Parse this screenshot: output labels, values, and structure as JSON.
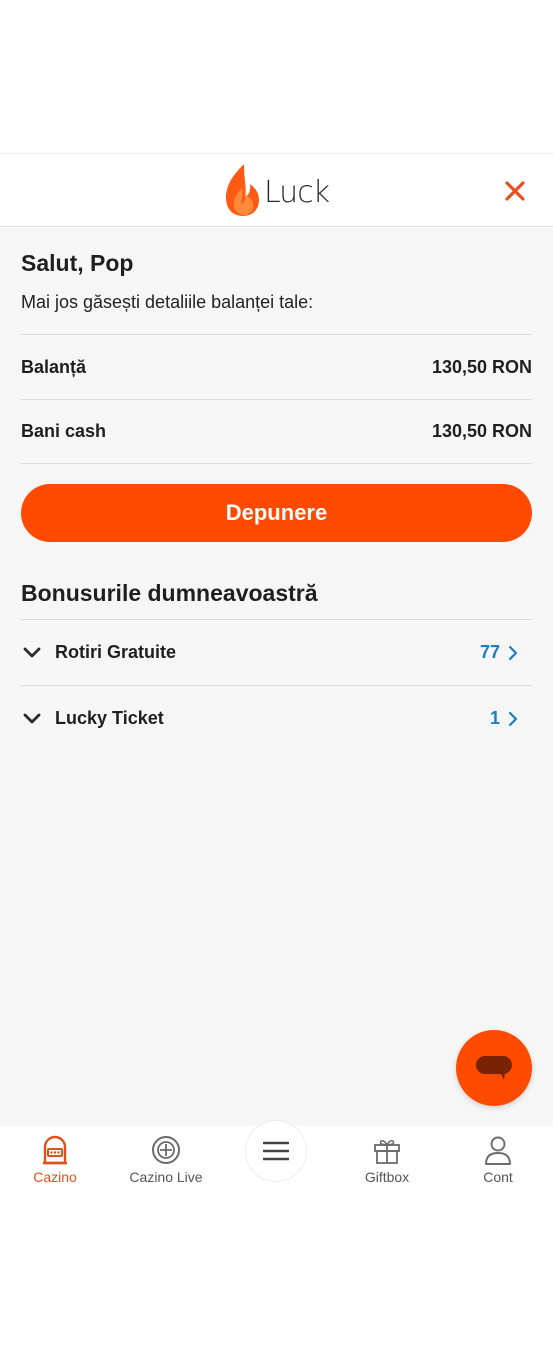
{
  "header": {
    "brand": "Luck"
  },
  "account": {
    "greeting": "Salut, Pop",
    "subtitle": "Mai jos găsești detaliile balanței tale:",
    "balances": [
      {
        "label": "Balanță",
        "value": "130,50 RON"
      },
      {
        "label": "Bani cash",
        "value": "130,50 RON"
      }
    ],
    "deposit_label": "Depunere"
  },
  "bonuses": {
    "title": "Bonusurile dumneavoastră",
    "items": [
      {
        "label": "Rotiri Gratuite",
        "count": "77"
      },
      {
        "label": "Lucky Ticket",
        "count": "1"
      }
    ]
  },
  "nav": {
    "items": [
      {
        "label": "Cazino",
        "icon": "slot-machine-icon",
        "active": true
      },
      {
        "label": "Cazino Live",
        "icon": "roulette-icon",
        "active": false
      },
      {
        "label": "",
        "icon": "menu-icon",
        "active": false
      },
      {
        "label": "Giftbox",
        "icon": "gift-icon",
        "active": false
      },
      {
        "label": "Cont",
        "icon": "user-icon",
        "active": false
      }
    ]
  },
  "colors": {
    "accent": "#ff4b00",
    "count_blue": "#1a7fc1",
    "background": "#f6f6f6"
  }
}
